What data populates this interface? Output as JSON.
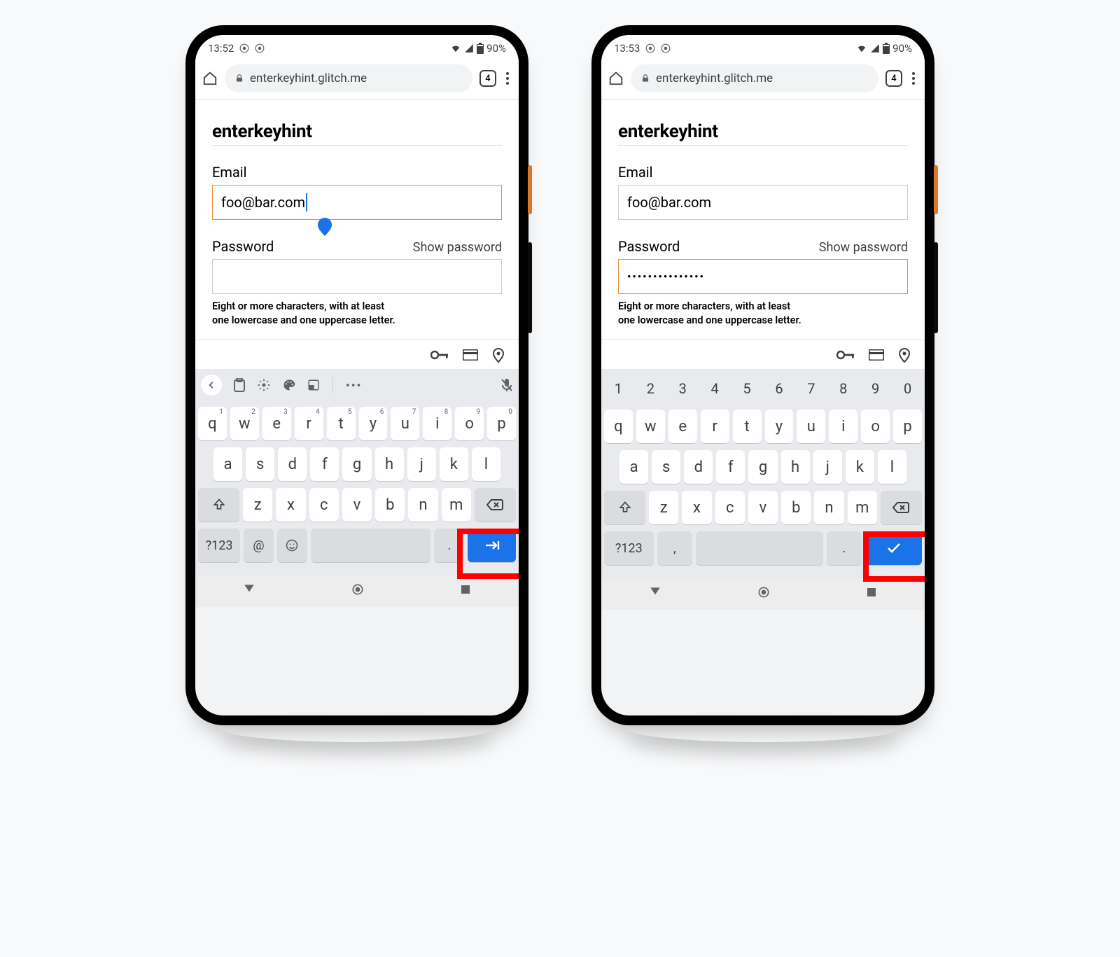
{
  "phones": [
    {
      "status": {
        "time": "13:52",
        "battery": "90%"
      },
      "browser": {
        "url": "enterkeyhint.glitch.me",
        "tab_count": "4"
      },
      "page": {
        "title": "enterkeyhint",
        "email_label": "Email",
        "email_value": "foo@bar.com",
        "password_label": "Password",
        "show_password": "Show password",
        "password_value": "",
        "hint_line1": "Eight or more characters, with at least",
        "hint_line2": "one lowercase and one uppercase letter."
      },
      "keyboard": {
        "mode": "email",
        "sym_label": "?123",
        "at_label": "@",
        "dot_label": ".",
        "row1": [
          "q",
          "w",
          "e",
          "r",
          "t",
          "y",
          "u",
          "i",
          "o",
          "p"
        ],
        "row1_sup": [
          "1",
          "2",
          "3",
          "4",
          "5",
          "6",
          "7",
          "8",
          "9",
          "0"
        ],
        "row2": [
          "a",
          "s",
          "d",
          "f",
          "g",
          "h",
          "j",
          "k",
          "l"
        ],
        "row3": [
          "z",
          "x",
          "c",
          "v",
          "b",
          "n",
          "m"
        ],
        "enter_kind": "next"
      }
    },
    {
      "status": {
        "time": "13:53",
        "battery": "90%"
      },
      "browser": {
        "url": "enterkeyhint.glitch.me",
        "tab_count": "4"
      },
      "page": {
        "title": "enterkeyhint",
        "email_label": "Email",
        "email_value": "foo@bar.com",
        "password_label": "Password",
        "show_password": "Show password",
        "password_value": "•••••••••••••••",
        "hint_line1": "Eight or more characters, with at least",
        "hint_line2": "one lowercase and one uppercase letter."
      },
      "keyboard": {
        "mode": "password",
        "sym_label": "?123",
        "comma_label": ",",
        "dot_label": ".",
        "nums": [
          "1",
          "2",
          "3",
          "4",
          "5",
          "6",
          "7",
          "8",
          "9",
          "0"
        ],
        "row1": [
          "q",
          "w",
          "e",
          "r",
          "t",
          "y",
          "u",
          "i",
          "o",
          "p"
        ],
        "row2": [
          "a",
          "s",
          "d",
          "f",
          "g",
          "h",
          "j",
          "k",
          "l"
        ],
        "row3": [
          "z",
          "x",
          "c",
          "v",
          "b",
          "n",
          "m"
        ],
        "enter_kind": "done"
      }
    }
  ]
}
